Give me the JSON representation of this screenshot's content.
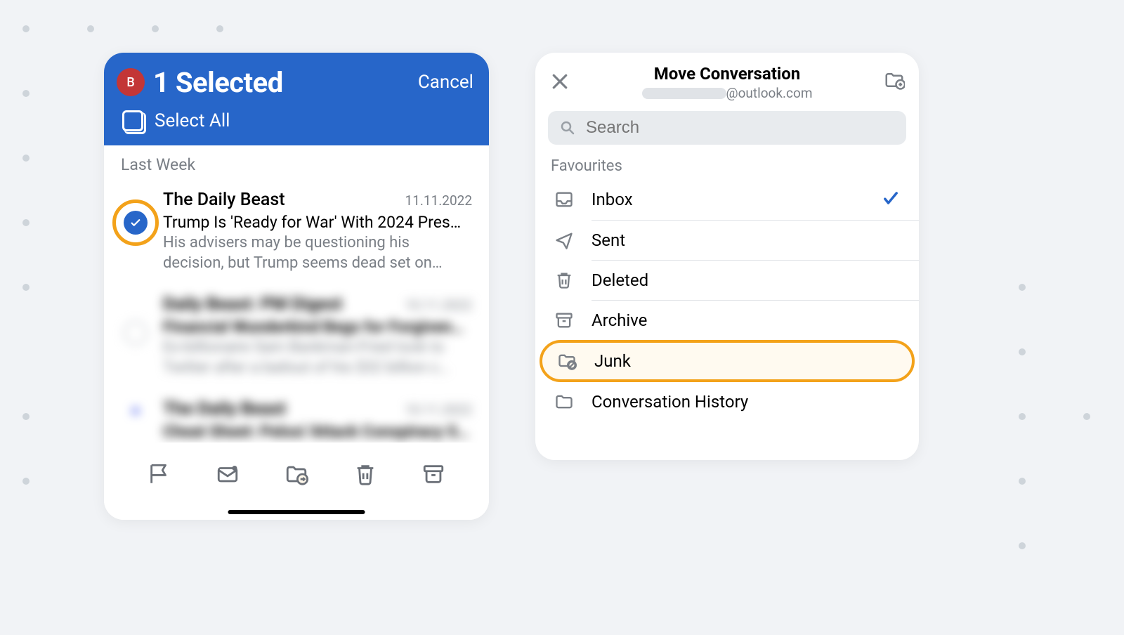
{
  "left": {
    "avatar_initial": "B",
    "title": "1 Selected",
    "cancel": "Cancel",
    "select_all": "Select All",
    "section": "Last Week",
    "items": [
      {
        "sender": "The Daily Beast",
        "date": "11.11.2022",
        "subject": "Trump Is 'Ready for War' With 2024 Pres…",
        "preview": "His advisers may be questioning his decision, but Trump seems dead set on…",
        "selected": true
      },
      {
        "sender": "Daily Beast: PM Digest",
        "date": "10.11.2022",
        "subject": "Financial Wunderkind Begs for Forgiven…",
        "preview": "Ex-billionaire Sam Bankman-Fried took to Twitter after a bailout of his $32 billion c…",
        "selected": false
      },
      {
        "sender": "The Daily Beast",
        "date": "10.11.2022",
        "subject": "Cheat Sheet: Pelosi 'Attack Conspiracy S…",
        "preview": "",
        "selected": false
      }
    ],
    "toolbar": [
      "flag",
      "mark-read",
      "move",
      "delete",
      "archive"
    ]
  },
  "right": {
    "title": "Move Conversation",
    "subtitle_suffix": "@outlook.com",
    "search_placeholder": "Search",
    "favourites_label": "Favourites",
    "folders": [
      {
        "name": "Inbox",
        "icon": "inbox",
        "current": true
      },
      {
        "name": "Sent",
        "icon": "sent"
      },
      {
        "name": "Deleted",
        "icon": "trash"
      },
      {
        "name": "Archive",
        "icon": "archive"
      },
      {
        "name": "Junk",
        "icon": "junk",
        "highlight": true
      },
      {
        "name": "Conversation History",
        "icon": "folder"
      }
    ]
  }
}
